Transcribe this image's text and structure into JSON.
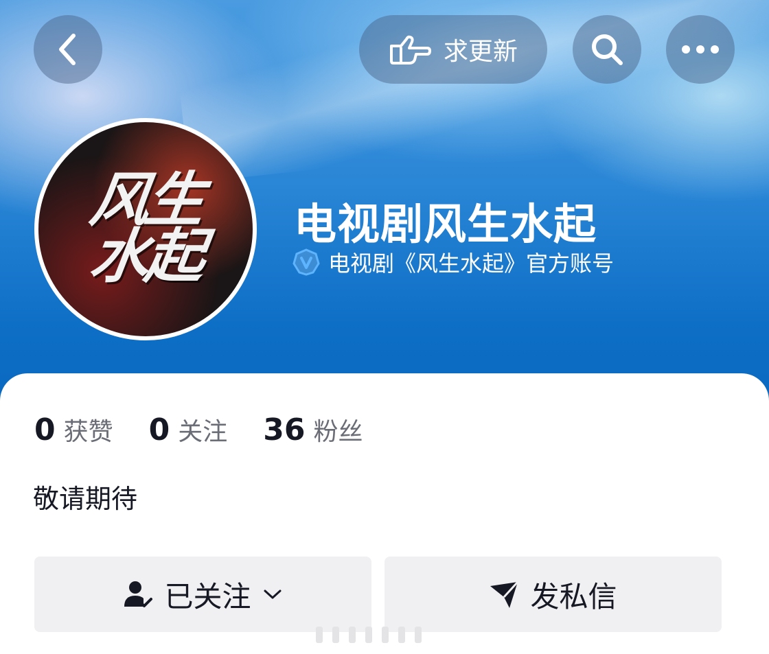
{
  "header": {
    "update_label": "求更新",
    "back_icon": "chevron-left-icon",
    "search_icon": "search-icon",
    "more_icon": "more-horizontal-icon"
  },
  "profile": {
    "avatar_text": [
      "风生",
      "水起"
    ],
    "name": "电视剧风生水起",
    "verified_label": "电视剧《风生水起》官方账号",
    "bio": "敬请期待"
  },
  "stats": [
    {
      "value": "0",
      "label": "获赞"
    },
    {
      "value": "0",
      "label": "关注"
    },
    {
      "value": "36",
      "label": "粉丝"
    }
  ],
  "actions": {
    "follow_label": "已关注",
    "message_label": "发私信"
  },
  "colors": {
    "header_blue": "#0e6fc6",
    "verified_badge": "#4aa8ff",
    "button_bg": "#f0f0f2",
    "text_primary": "#161823",
    "text_secondary": "#6b6d76"
  }
}
